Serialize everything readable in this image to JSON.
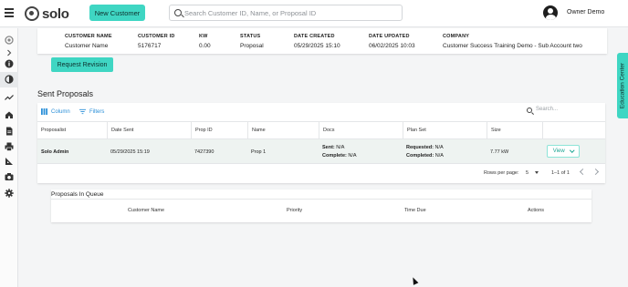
{
  "header": {
    "logo_text": "solo",
    "new_customer_label": "New Customer",
    "search_placeholder": "Search Customer ID, Name, or Proposal ID",
    "user_name": "Owner Demo"
  },
  "customer_info": {
    "columns": [
      {
        "header": "CUSTOMER NAME",
        "value": "Customer Name"
      },
      {
        "header": "CUSTOMER ID",
        "value": "5176717"
      },
      {
        "header": "KW",
        "value": "0.00"
      },
      {
        "header": "STATUS",
        "value": "Proposal"
      },
      {
        "header": "DATE CREATED",
        "value": "05/29/2025 15:10"
      },
      {
        "header": "DATE UPDATED",
        "value": "06/02/2025 10:03"
      },
      {
        "header": "COMPANY",
        "value": "Customer Success Training Demo - Sub Account two"
      }
    ]
  },
  "request_revision_label": "Request Revision",
  "sent_proposals": {
    "title": "Sent Proposals",
    "columns_label": "Column",
    "filters_label": "Filters",
    "search_placeholder": "Search...",
    "headers": [
      "Proposalist",
      "Date Sent",
      "Prop ID",
      "Name",
      "Docs",
      "Plan Set",
      "Size"
    ],
    "row": {
      "proposalist": "Solo Admin",
      "date_sent": "05/29/2025 15:19",
      "prop_id": "7427390",
      "name": "Prop 1",
      "docs_sent_label": "Sent:",
      "docs_sent_value": "N/A",
      "docs_complete_label": "Complete:",
      "docs_complete_value": "N/A",
      "plan_requested_label": "Requested:",
      "plan_requested_value": "N/A",
      "plan_completed_label": "Completed:",
      "plan_completed_value": "N/A",
      "size": "7.77 kW",
      "view_label": "View"
    },
    "pagination": {
      "rows_per_page_label": "Rows per page:",
      "rows_per_page_value": "5",
      "range": "1–1 of 1"
    }
  },
  "queue": {
    "title": "Proposals In Queue",
    "headers": [
      "Customer Name",
      "Priority",
      "Time Due",
      "Actions"
    ]
  },
  "education_center_label": "Education Center",
  "sidebar": {
    "icons": [
      "logo-icon",
      "chevron-right-icon",
      "info-icon",
      "contrast-icon",
      "trend-icon",
      "home-icon",
      "document-icon",
      "print-icon",
      "ruler-icon",
      "camera-icon",
      "gear-icon"
    ]
  },
  "colors": {
    "accent": "#3fd6c3",
    "link": "#2a8fd8"
  }
}
